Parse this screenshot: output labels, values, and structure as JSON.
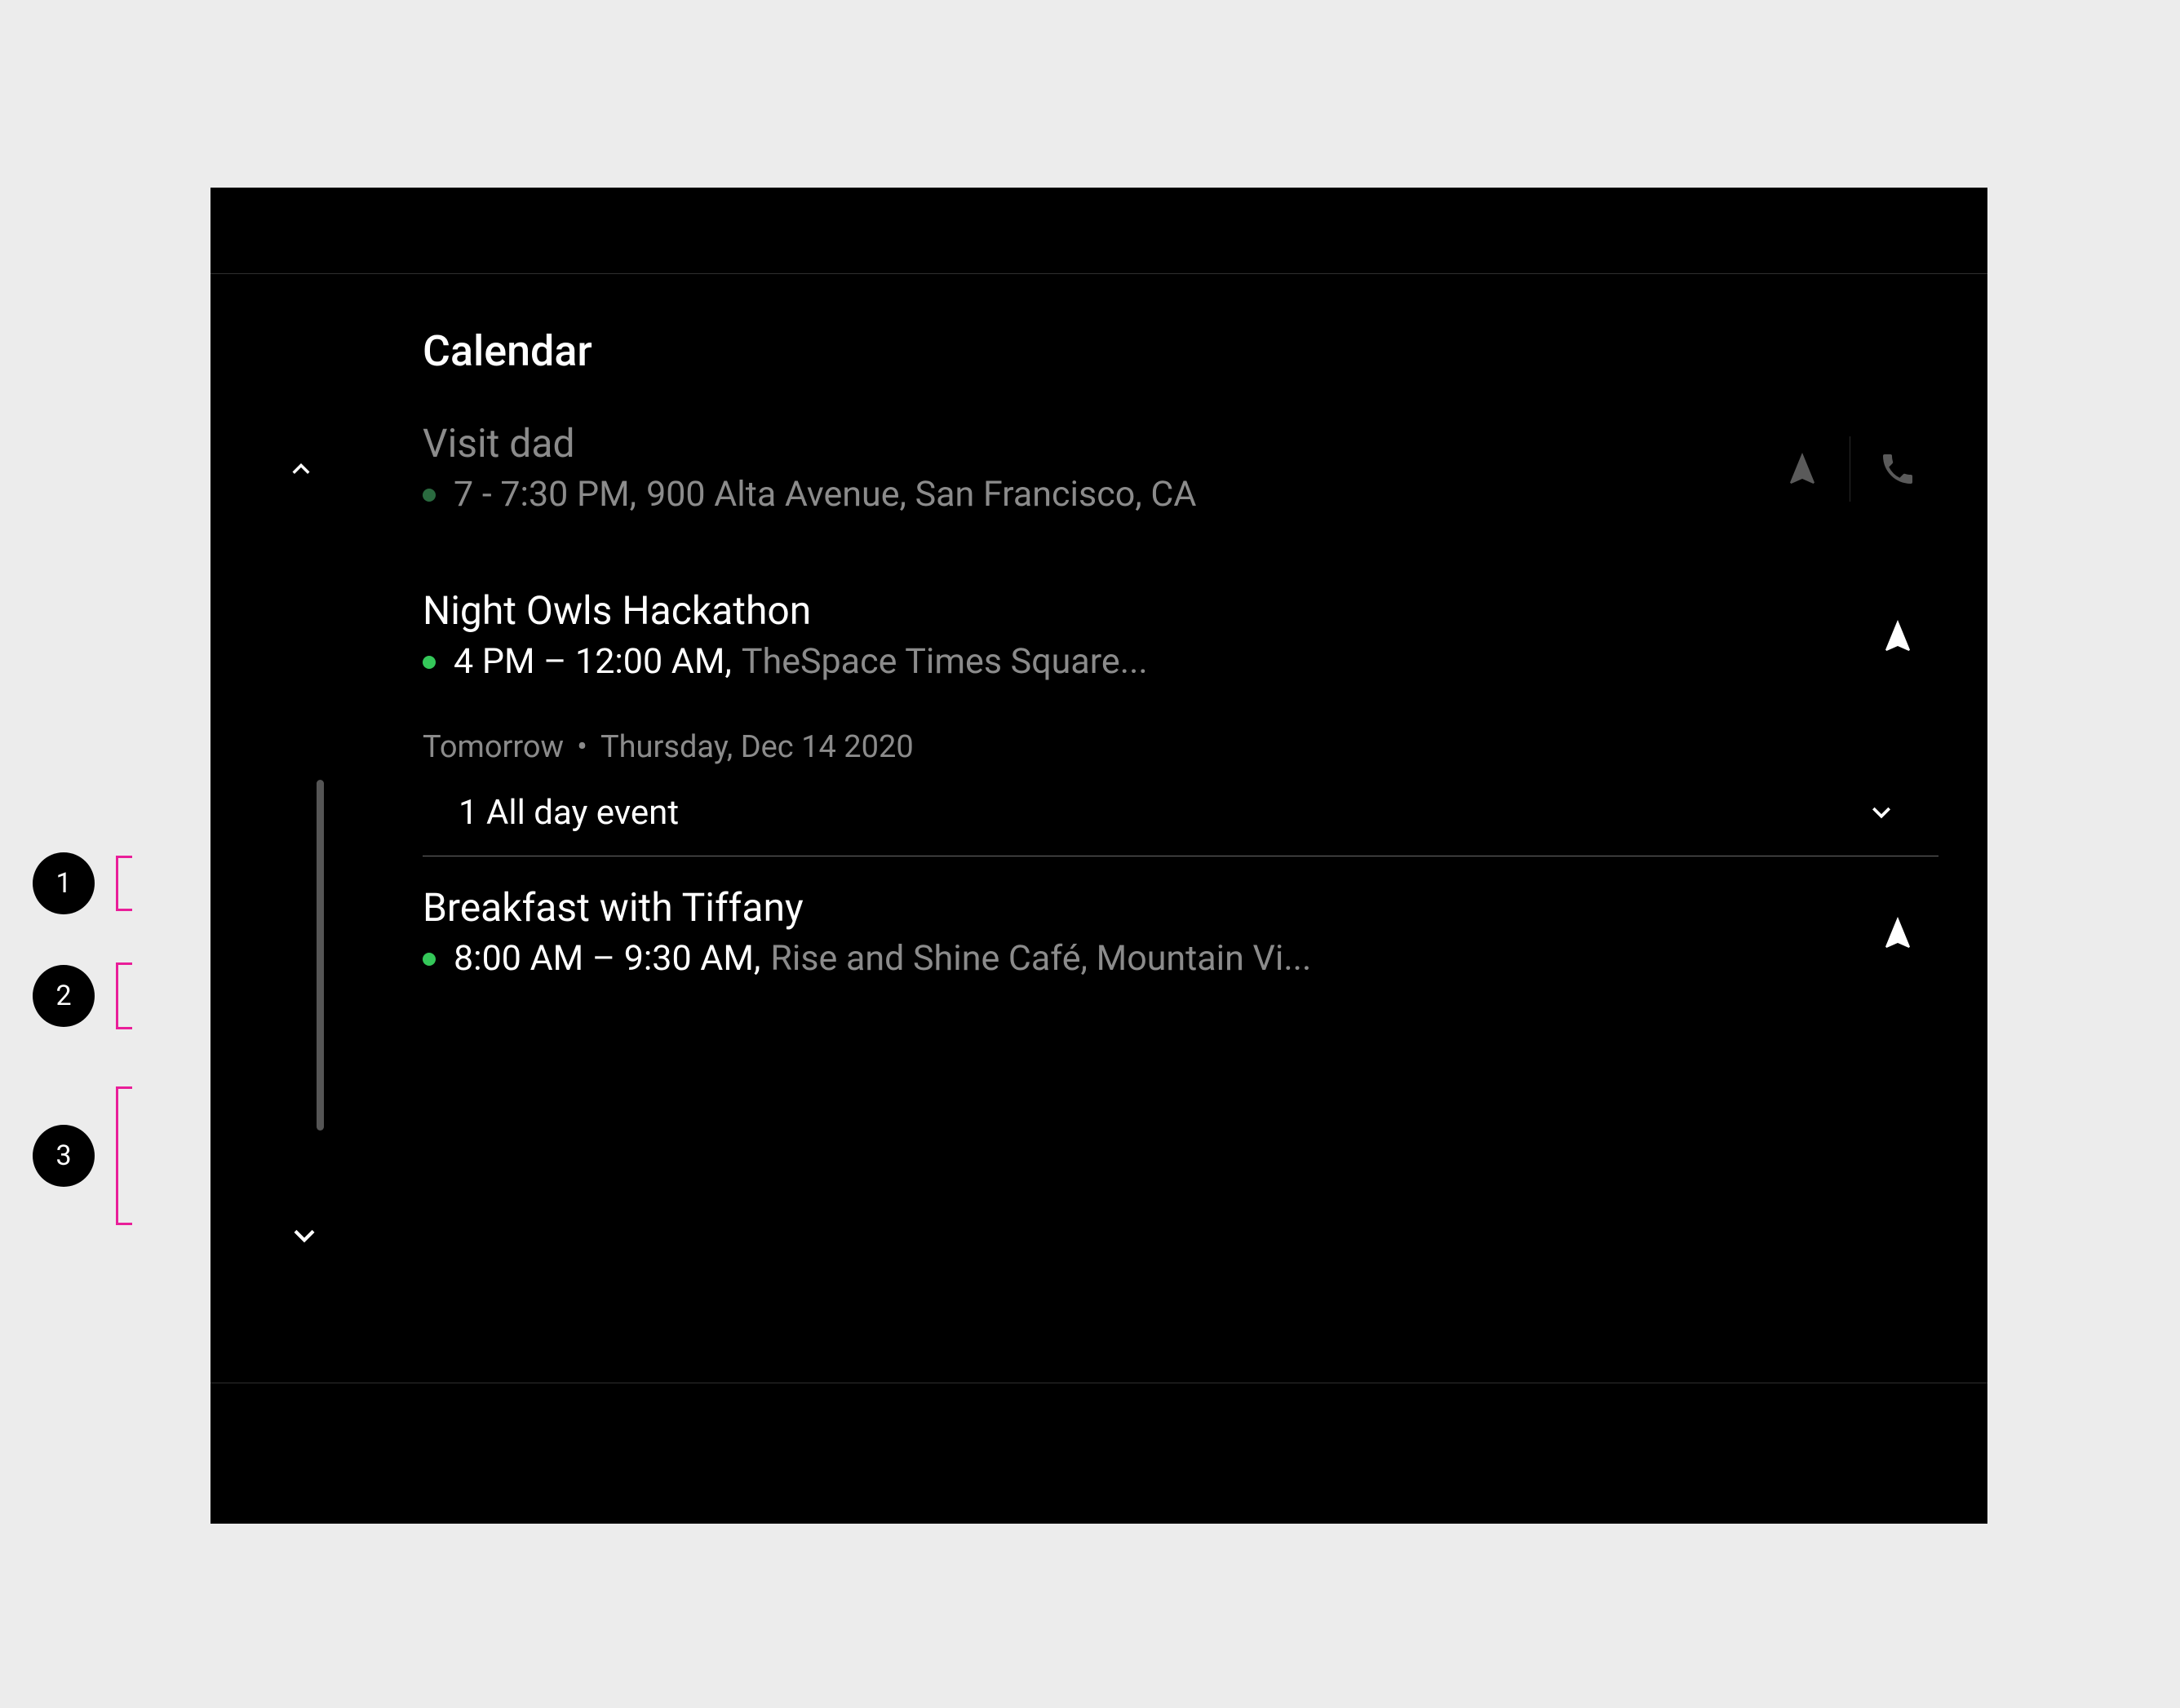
{
  "page": {
    "title": "Calendar"
  },
  "events": [
    {
      "title": "Visit dad",
      "time": "7 - 7:30 PM,",
      "location": "900 Alta Avenue, San Francisco, CA",
      "status_color": "green-dim",
      "dimmed": true,
      "actions": [
        "navigate",
        "call"
      ]
    },
    {
      "title": "Night Owls Hackathon",
      "time": "4 PM – 12:00 AM,",
      "location": "TheSpace Times Square...",
      "status_color": "green",
      "dimmed": false,
      "actions": [
        "navigate"
      ]
    }
  ],
  "section_header": {
    "prefix": "Tomorrow",
    "separator": "•",
    "date": "Thursday, Dec 14 2020"
  },
  "allday": {
    "label": "1 All day event"
  },
  "tomorrow_events": [
    {
      "title": "Breakfast with Tiffany",
      "time": "8:00 AM – 9:30 AM,",
      "location": "Rise and Shine Café, Mountain Vi...",
      "status_color": "green",
      "dimmed": false,
      "actions": [
        "navigate"
      ]
    }
  ],
  "callouts": [
    {
      "num": "1"
    },
    {
      "num": "2"
    },
    {
      "num": "3"
    }
  ]
}
